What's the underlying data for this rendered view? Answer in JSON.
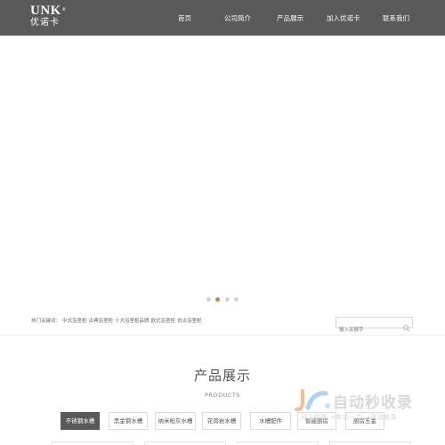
{
  "logo": {
    "en": "UNK",
    "mark": "®",
    "cn": "优诺卡"
  },
  "nav": {
    "items": [
      "首页",
      "公司简介",
      "产品展示",
      "加入优诺卡",
      "联系我们"
    ]
  },
  "carousel": {
    "slide_count": 4,
    "active_index": 1
  },
  "keywords": {
    "label": "热门关键词：",
    "items": [
      "中式浴室柜",
      "古典浴室柜",
      "十大浴室柜品牌",
      "欧式浴室柜",
      "仿古浴室柜"
    ]
  },
  "search": {
    "placeholder": "输入关键字"
  },
  "products": {
    "title": "产品展示",
    "subtitle": "PRODUCTS",
    "tabs": [
      "不锈钢水槽",
      "黑金钢水槽",
      "纳米枪灰水槽",
      "花岗岩水槽",
      "水槽配件",
      "智能厨房",
      "厨房五金"
    ],
    "active_tab": 0
  },
  "watermark": {
    "text": "自动秒收录",
    "sub": "网上链接 →来访一次 →自动收录"
  },
  "colors": {
    "header": "#595959",
    "accent": "#c08a5a",
    "tab_active": "#595959"
  }
}
